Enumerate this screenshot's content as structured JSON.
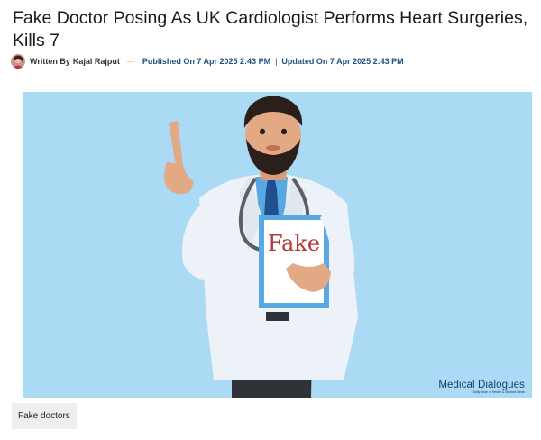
{
  "article": {
    "title": "Fake Doctor Posing As UK Cardiologist Performs Heart Surgeries, Kills 7",
    "byline_prefix": "Written By",
    "author": "Kajal Rajput",
    "separator": "—",
    "published": "Published On 7 Apr 2025 2:43 PM",
    "pipe": "|",
    "updated": "Updated On 7 Apr 2025 2:43 PM"
  },
  "hero": {
    "board_text": "Fake",
    "watermark_title": "Medical Dialogues",
    "watermark_sub": "Daily dose of Health & Medical News"
  },
  "caption": {
    "tag": "Fake doctors"
  }
}
